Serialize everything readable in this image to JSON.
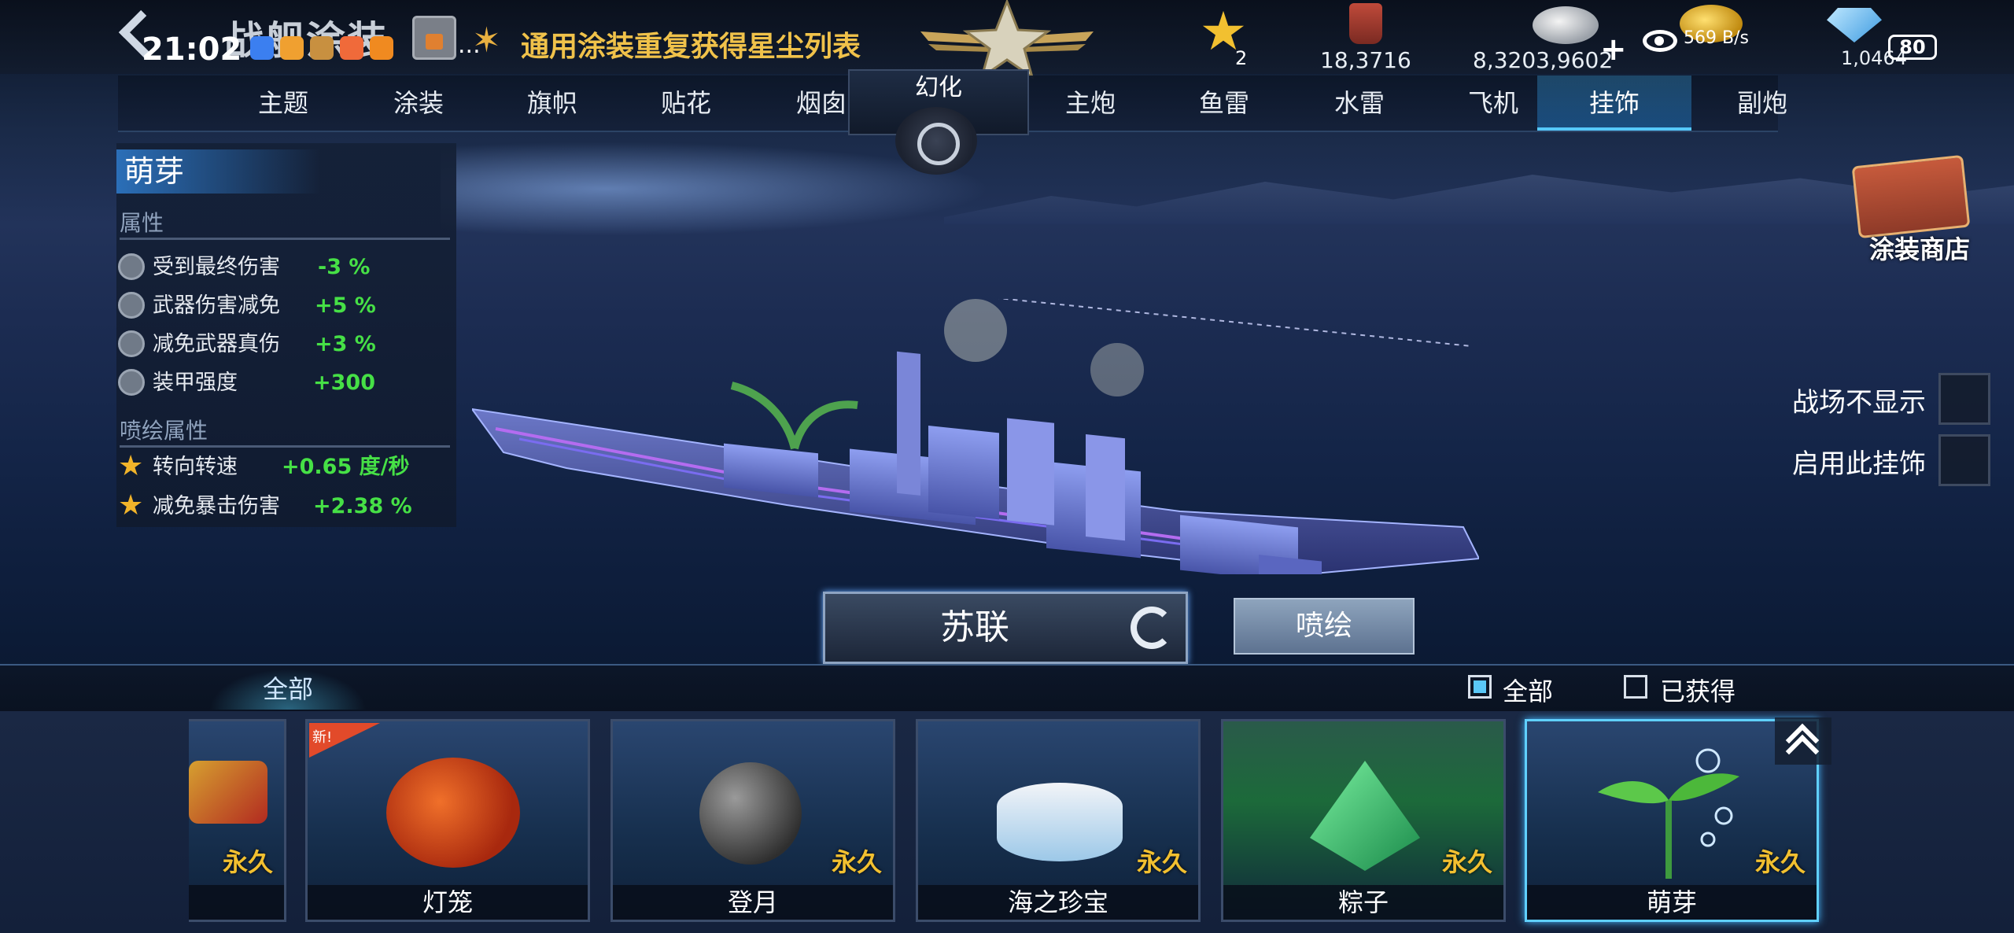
{
  "header": {
    "title": "战舰涂装",
    "stardust_link": "通用涂装重复获得星尘列表",
    "resources": {
      "stars": "2",
      "paint": "18,3716",
      "silver": "8,3203,9602",
      "silver_plus": "+",
      "diamond": "1,0464"
    }
  },
  "status_bar": {
    "time": "21:02",
    "dots": "...",
    "network": "569 B/s",
    "battery": "80"
  },
  "tabs": [
    {
      "label": "主题"
    },
    {
      "label": "涂装"
    },
    {
      "label": "旗帜"
    },
    {
      "label": "贴花"
    },
    {
      "label": "烟囱"
    },
    {
      "label": "幻化"
    },
    {
      "label": "主炮"
    },
    {
      "label": "鱼雷"
    },
    {
      "label": "水雷"
    },
    {
      "label": "飞机"
    },
    {
      "label": "挂饰",
      "active": true
    },
    {
      "label": "副炮"
    }
  ],
  "attributes": {
    "name": "萌芽",
    "section1": "属性",
    "rows": [
      {
        "name": "受到最终伤害",
        "value": "-3 %"
      },
      {
        "name": "武器伤害减免",
        "value": "+5 %"
      },
      {
        "name": "减免武器真伤",
        "value": "+3 %"
      },
      {
        "name": "装甲强度",
        "value": "+300"
      }
    ],
    "section2": "喷绘属性",
    "paint_rows": [
      {
        "name": "转向转速",
        "value": "+0.65 度/秒"
      },
      {
        "name": "减免暴击伤害",
        "value": "+2.38 %"
      }
    ]
  },
  "options": {
    "hide_in_battle": "战场不显示",
    "enable_ornament": "启用此挂饰",
    "shop": "涂装商店"
  },
  "controls": {
    "nation": "苏联",
    "paint": "喷绘"
  },
  "filter": {
    "tab_all": "全部",
    "check_all": "全部",
    "check_owned": "已获得"
  },
  "cards": [
    {
      "name": "",
      "duration": "永久"
    },
    {
      "name": "灯笼",
      "duration": "",
      "badge": "新!"
    },
    {
      "name": "登月",
      "duration": "永久"
    },
    {
      "name": "海之珍宝",
      "duration": "永久"
    },
    {
      "name": "粽子",
      "duration": "永久"
    },
    {
      "name": "萌芽",
      "duration": "永久",
      "selected": true
    }
  ],
  "colors": {
    "accent": "#56c8ff",
    "gold": "#f2c030",
    "positive": "#46e046"
  }
}
